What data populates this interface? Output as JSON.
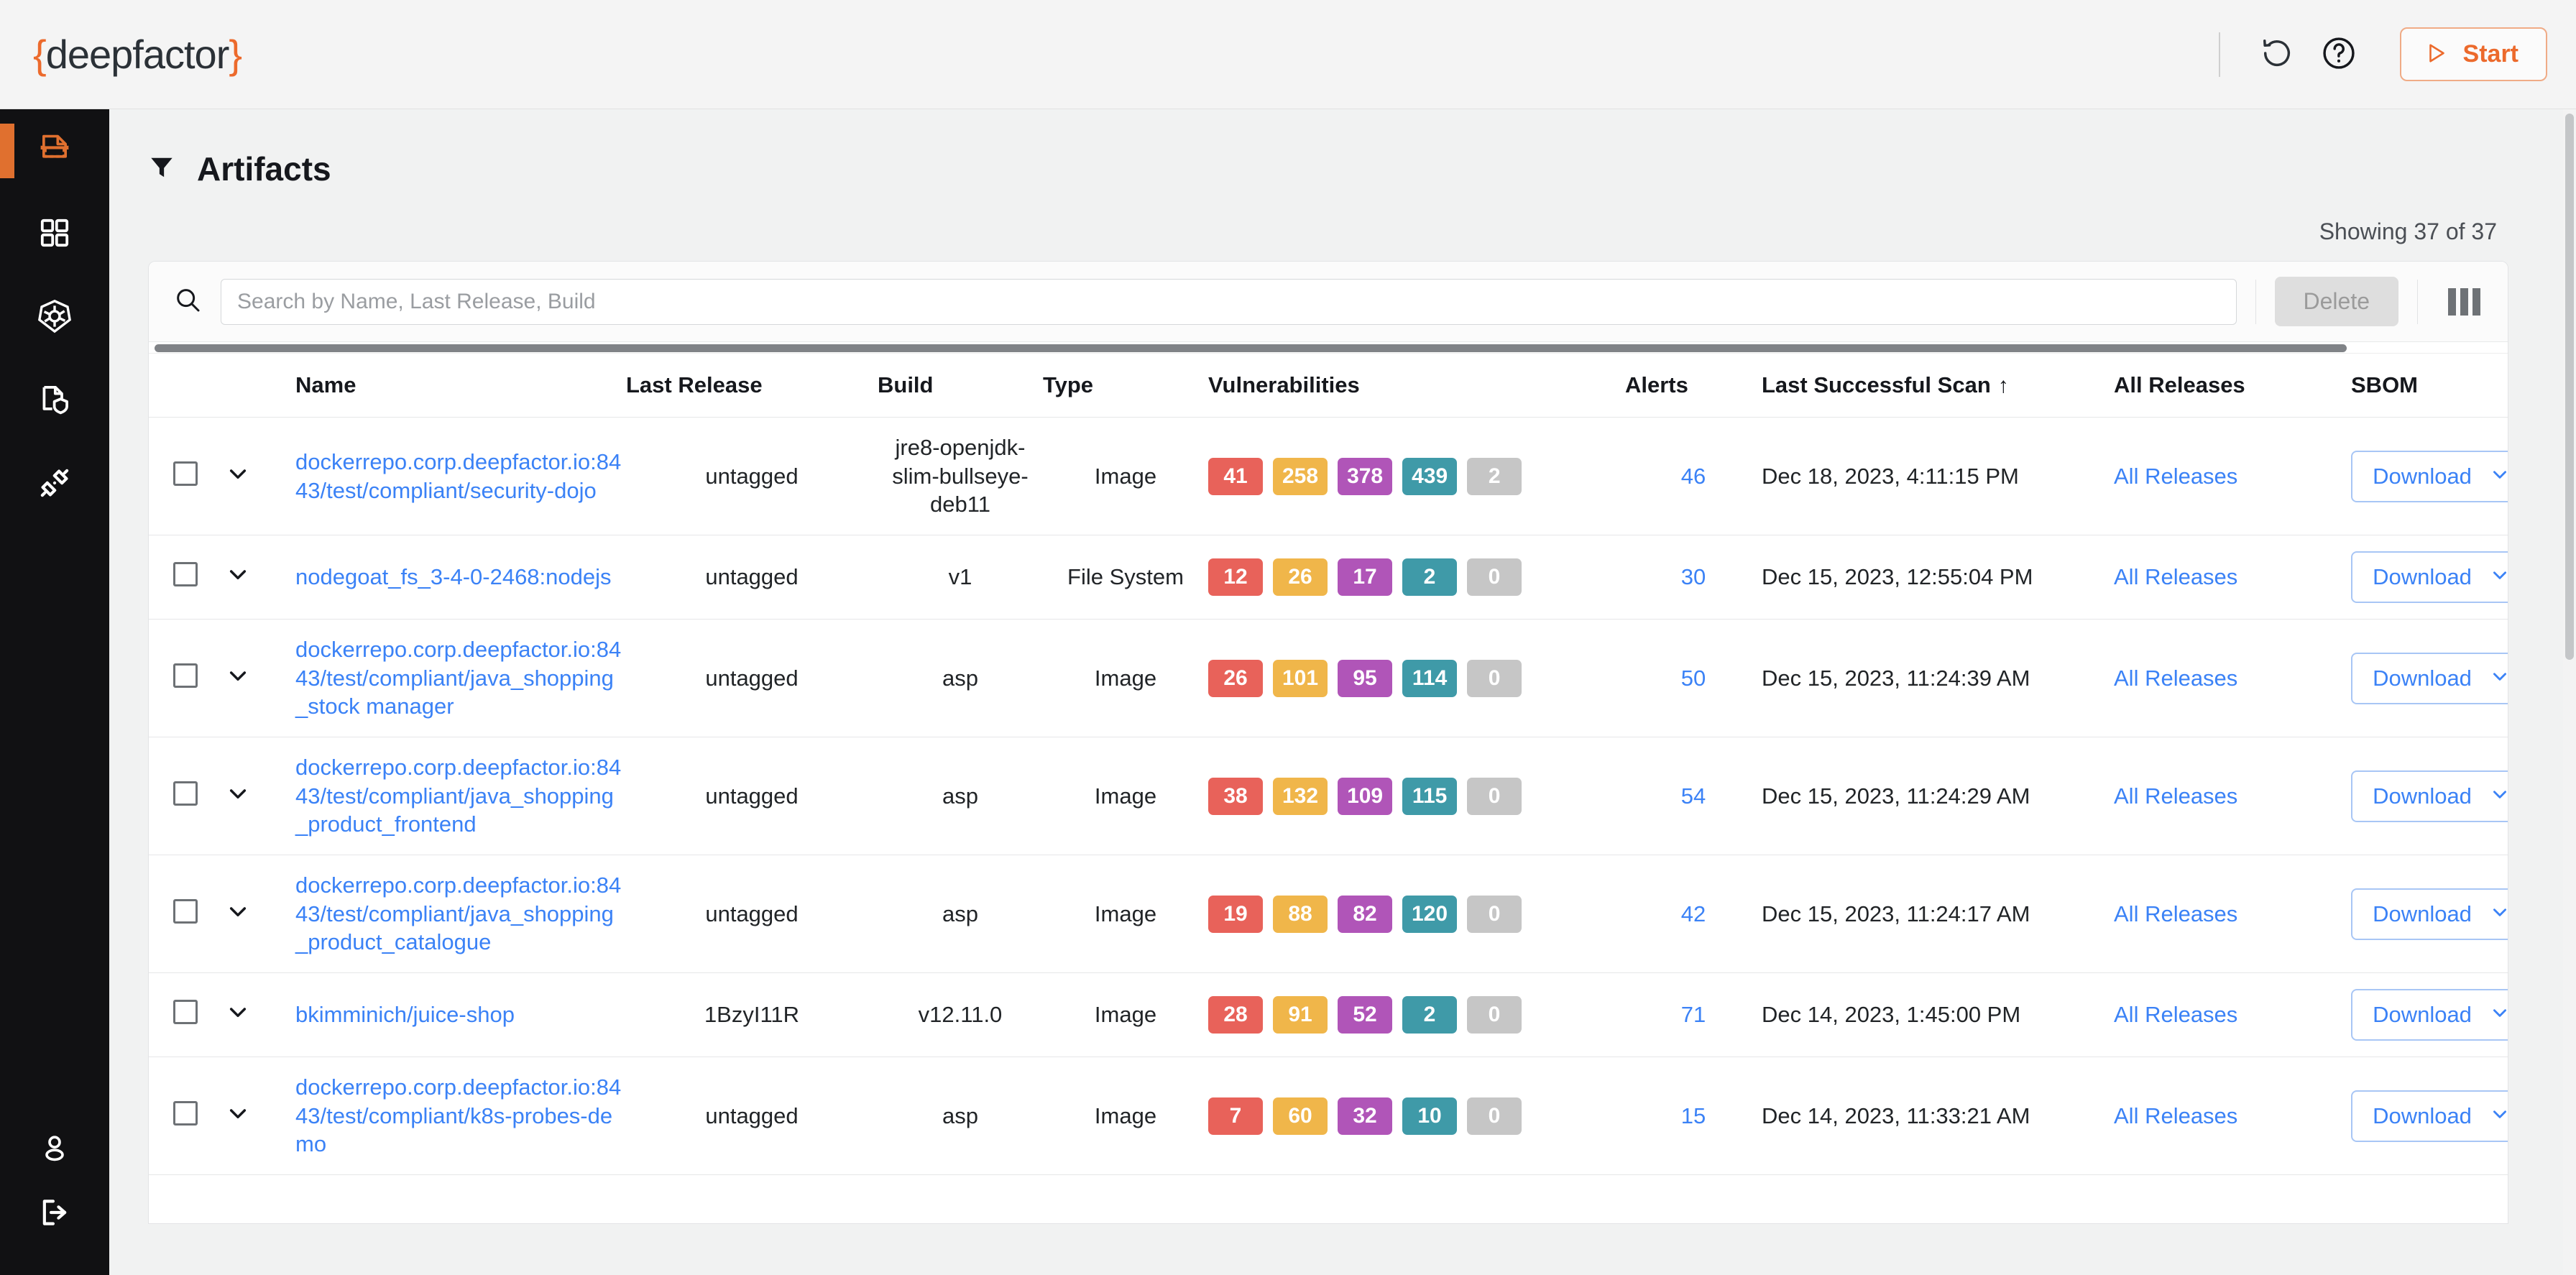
{
  "topbar": {
    "logo_open": "{",
    "logo_text": "deepfactor",
    "logo_close": "}",
    "refresh_icon": "refresh-icon",
    "help_icon": "help-icon",
    "start_label": "Start"
  },
  "sidebar": {
    "items": [
      {
        "name": "artifacts",
        "icon": "artifact-icon",
        "active": true
      },
      {
        "name": "dashboard",
        "icon": "grid-icon",
        "active": false
      },
      {
        "name": "kubernetes",
        "icon": "kubernetes-helm-icon",
        "active": false
      },
      {
        "name": "compliance",
        "icon": "document-shield-icon",
        "active": false
      },
      {
        "name": "integrations",
        "icon": "plug-connector-icon",
        "active": false
      }
    ],
    "bottom_items": [
      {
        "name": "user-profile",
        "icon": "user-icon"
      },
      {
        "name": "logout",
        "icon": "logout-icon"
      }
    ]
  },
  "page": {
    "filter_icon": "filter-funnel-icon",
    "title": "Artifacts",
    "showing": "Showing 37 of 37"
  },
  "toolbar": {
    "search_icon": "search-icon",
    "search_value": "",
    "search_placeholder": "Search by Name, Last Release, Build",
    "delete_label": "Delete",
    "columns_icon": "columns-icon"
  },
  "table": {
    "columns": [
      "Name",
      "Last Release",
      "Build",
      "Type",
      "Vulnerabilities",
      "Alerts",
      "Last Successful Scan",
      "All Releases",
      "SBOM"
    ],
    "sorted_column": "Last Successful Scan",
    "sort_direction": "↑",
    "download_label": "Download",
    "all_releases_label": "All Releases",
    "rows": [
      {
        "name": "dockerrepo.corp.deepfactor.io:8443/test/compliant/security-dojo",
        "last_release": "untagged",
        "build": "jre8-openjdk-slim-bullseye-deb11",
        "type": "Image",
        "vulnerabilities": {
          "critical": "41",
          "high": "258",
          "medium": "378",
          "low": "439",
          "none": "2"
        },
        "alerts": "46",
        "last_scan": "Dec 18, 2023, 4:11:15 PM"
      },
      {
        "name": "nodegoat_fs_3-4-0-2468:nodejs",
        "last_release": "untagged",
        "build": "v1",
        "type": "File System",
        "vulnerabilities": {
          "critical": "12",
          "high": "26",
          "medium": "17",
          "low": "2",
          "none": "0"
        },
        "alerts": "30",
        "last_scan": "Dec 15, 2023, 12:55:04 PM"
      },
      {
        "name": "dockerrepo.corp.deepfactor.io:8443/test/compliant/java_shopping_stock manager",
        "last_release": "untagged",
        "build": "asp",
        "type": "Image",
        "vulnerabilities": {
          "critical": "26",
          "high": "101",
          "medium": "95",
          "low": "114",
          "none": "0"
        },
        "alerts": "50",
        "last_scan": "Dec 15, 2023, 11:24:39 AM"
      },
      {
        "name": "dockerrepo.corp.deepfactor.io:8443/test/compliant/java_shopping_product_frontend",
        "last_release": "untagged",
        "build": "asp",
        "type": "Image",
        "vulnerabilities": {
          "critical": "38",
          "high": "132",
          "medium": "109",
          "low": "115",
          "none": "0"
        },
        "alerts": "54",
        "last_scan": "Dec 15, 2023, 11:24:29 AM"
      },
      {
        "name": "dockerrepo.corp.deepfactor.io:8443/test/compliant/java_shopping_product_catalogue",
        "last_release": "untagged",
        "build": "asp",
        "type": "Image",
        "vulnerabilities": {
          "critical": "19",
          "high": "88",
          "medium": "82",
          "low": "120",
          "none": "0"
        },
        "alerts": "42",
        "last_scan": "Dec 15, 2023, 11:24:17 AM"
      },
      {
        "name": "bkimminich/juice-shop",
        "last_release": "1BzyI11R",
        "build": "v12.11.0",
        "type": "Image",
        "vulnerabilities": {
          "critical": "28",
          "high": "91",
          "medium": "52",
          "low": "2",
          "none": "0"
        },
        "alerts": "71",
        "last_scan": "Dec 14, 2023, 1:45:00 PM"
      },
      {
        "name": "dockerrepo.corp.deepfactor.io:8443/test/compliant/k8s-probes-demo",
        "last_release": "untagged",
        "build": "asp",
        "type": "Image",
        "vulnerabilities": {
          "critical": "7",
          "high": "60",
          "medium": "32",
          "low": "10",
          "none": "0"
        },
        "alerts": "15",
        "last_scan": "Dec 14, 2023, 11:33:21 AM"
      }
    ]
  },
  "colors": {
    "brand_orange": "#ec6a2c",
    "link_blue": "#3b82f6",
    "critical": "#e8625a",
    "high": "#f0b64a",
    "medium": "#b055b8",
    "low": "#3f9aa8",
    "none": "#c6c6c6"
  }
}
